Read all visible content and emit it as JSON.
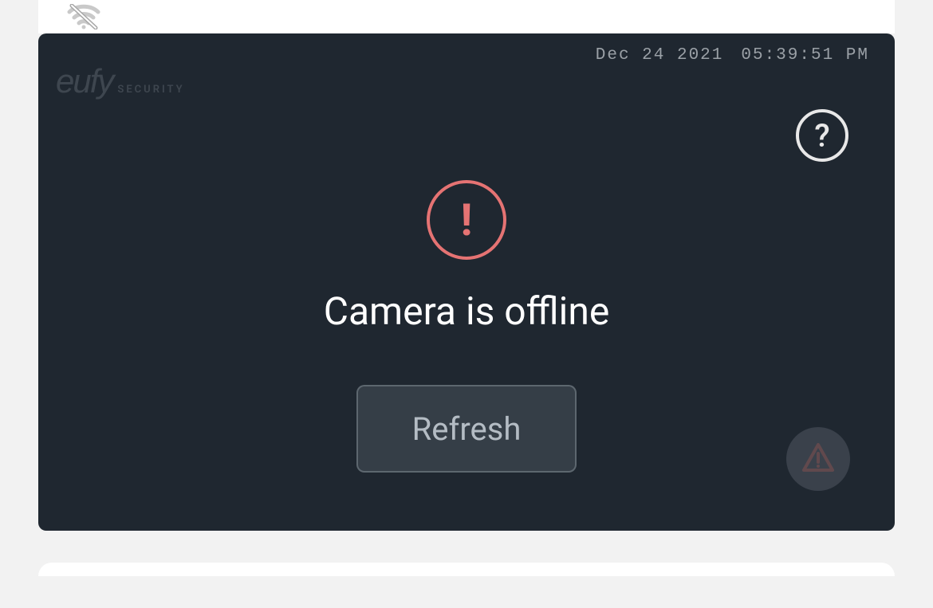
{
  "brand": {
    "name": "eufy",
    "subline": "SECURITY"
  },
  "timestamp": {
    "date": "Dec 24 2021",
    "time": "05:39:51 PM"
  },
  "status": {
    "message": "Camera is offline"
  },
  "actions": {
    "refresh_label": "Refresh"
  },
  "icons": {
    "help": "?",
    "exclamation": "!"
  }
}
